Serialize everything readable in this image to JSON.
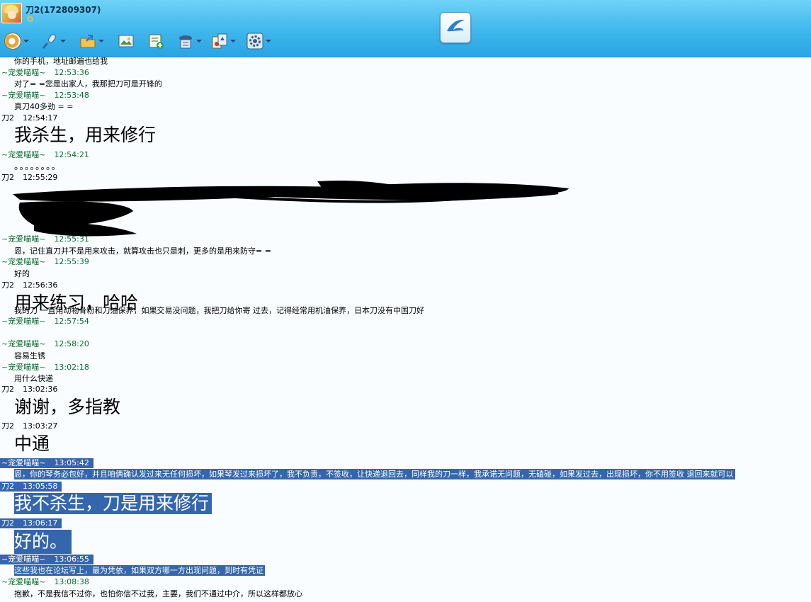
{
  "window": {
    "title": "刀2(172809307)"
  },
  "icons": {
    "status": "star-status-icon",
    "toolbar": [
      "video-call-icon",
      "microphone-icon",
      "send-file-icon",
      "photo-icon",
      "add-contact-icon",
      "remote-assist-icon",
      "apps-icon",
      "settings-icon"
    ],
    "logo": "swallow-logo-icon"
  },
  "colors": {
    "header": "#3fb6ec",
    "selection": "#3466ad",
    "peer_name": "#0a6d2c"
  },
  "messages": [
    {
      "name": "",
      "time": "",
      "text": "你的手机，地址邮遍也给我"
    },
    {
      "name": "~宠爱喵喵~",
      "time": "12:53:36",
      "text": "对了= =您是出家人，我那把刀可是开锋的"
    },
    {
      "name": "~宠爱喵喵~",
      "time": "12:53:48",
      "text": "真刀40多劲 = ="
    },
    {
      "name": "刀2",
      "time": "12:54:17",
      "text": "我杀生，用来修行"
    },
    {
      "name": "~宠爱喵喵~",
      "time": "12:54:21",
      "text": "。。。。。。。。"
    },
    {
      "name": "刀2",
      "time": "12:55:29",
      "text": ""
    },
    {
      "name": "~宠爱喵喵~",
      "time": "12:55:31",
      "text": "恩，记住直刀并不是用来攻击，就算攻击也只是刺，更多的是用来防守= ="
    },
    {
      "name": "~宠爱喵喵~",
      "time": "12:55:39",
      "text": "好的"
    },
    {
      "name": "刀2",
      "time": "12:56:36",
      "text": "用来练习，哈哈"
    },
    {
      "name": "~宠爱喵喵~",
      "time": "12:57:54",
      "text": "我的刀 一直用动物骨粉和刀油保养，如果交易没问题，我把刀给你寄 过去，记得经常用机油保养，日本刀没有中国刀好"
    },
    {
      "name": "~宠爱喵喵~",
      "time": "12:58:20",
      "text": "容易生锈"
    },
    {
      "name": "~宠爱喵喵~",
      "time": "13:02:18",
      "text": "用什么快递"
    },
    {
      "name": "刀2",
      "time": "13:02:36",
      "text": "谢谢，多指教"
    },
    {
      "name": "刀2",
      "time": "13:03:27",
      "text": "中通"
    },
    {
      "name": "~宠爱喵喵~",
      "time": "13:05:42",
      "text": "恩，你的琴务必包好，并且咱俩确认发过来无任何损坏，如果琴发过来损坏了，我不负责，不签收，让快递退回去，同样我的刀一样，我承诺无问题，无磕碰，如果发过去，出现损坏，你不用签收 退回来就可以"
    },
    {
      "name": "刀2",
      "time": "13:05:58",
      "text": "我不杀生，刀是用来修行"
    },
    {
      "name": "刀2",
      "time": "13:06:17",
      "text": "好的。"
    },
    {
      "name": "~宠爱喵喵~",
      "time": "13:06:55",
      "text": "这些我也在论坛写上，最为凭依，如果双方哪一方出现问题，到时有凭证"
    },
    {
      "name": "~宠爱喵喵~",
      "time": "13:08:38",
      "text": "抱歉，不是我信不过你，也怕你信不过我，主要，我们不通过中介，所以这样都放心"
    }
  ]
}
